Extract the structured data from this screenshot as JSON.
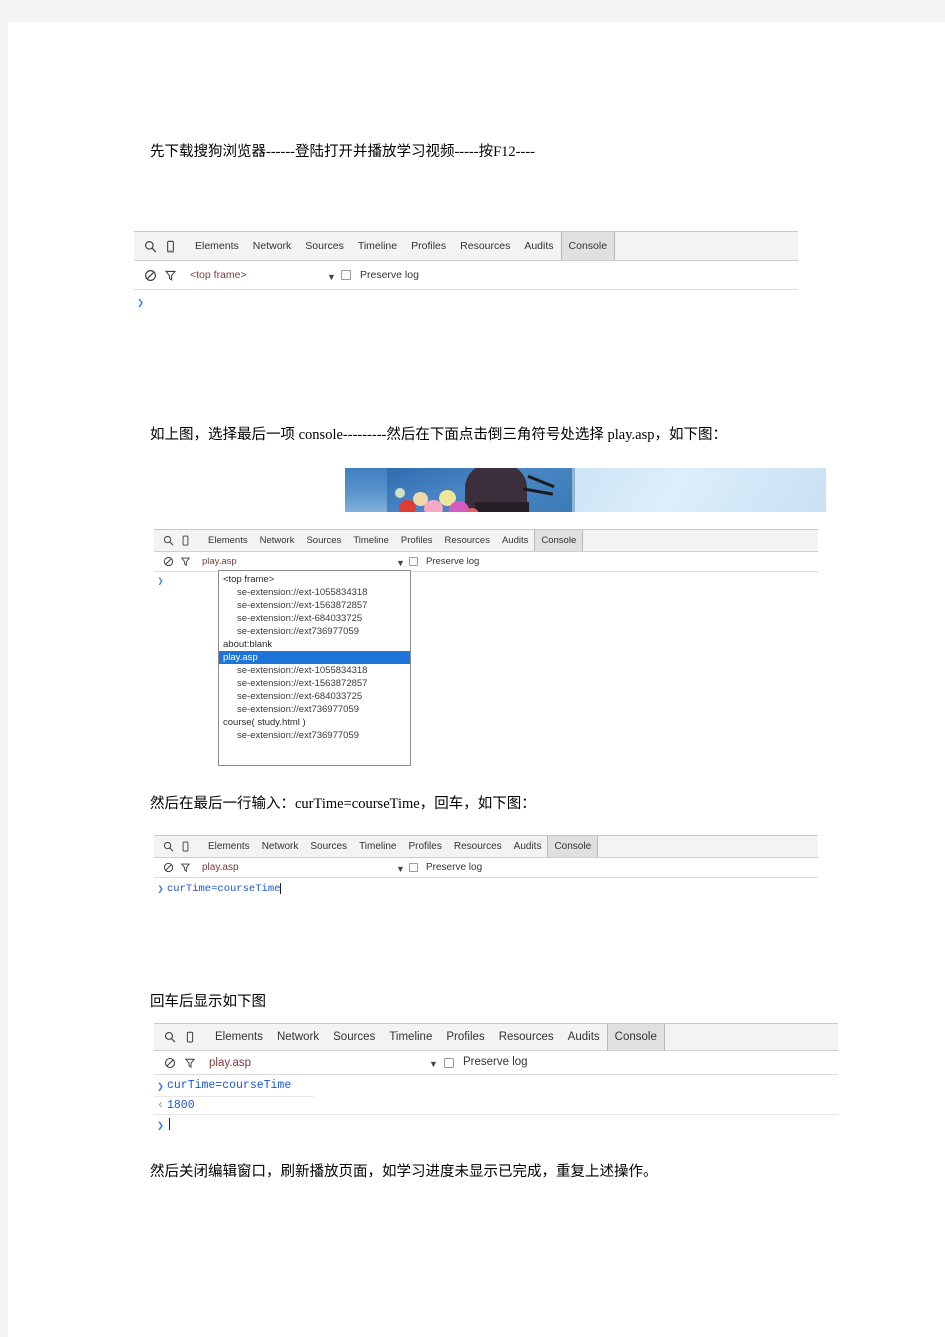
{
  "document": {
    "paragraphs": [
      "先下载搜狗浏览器------登陆打开并播放学习视频-----按F12----",
      "如上图，选择最后一项 console---------然后在下面点击倒三角符号处选择  play.asp，如下图：",
      "然后在最后一行输入：curTime=courseTime，回车，如下图：",
      "回车后显示如下图",
      "然后关闭编辑窗口，刷新播放页面，如学习进度未显示已完成，重复上述操作。"
    ]
  },
  "devtools": {
    "tabs": [
      "Elements",
      "Network",
      "Sources",
      "Timeline",
      "Profiles",
      "Resources",
      "Audits",
      "Console"
    ],
    "active_tab": "Console",
    "icons": {
      "search": "search-icon",
      "device": "device-toggle-icon",
      "clear": "clear-console-icon",
      "filter": "filter-icon",
      "caret": "▼"
    },
    "preserve_log_label": "Preserve log",
    "preserve_log_checked": false
  },
  "panel1": {
    "context": "<top frame>",
    "prompt_symbol": "❯"
  },
  "panel2": {
    "context": "play.asp",
    "prompt_symbol": "❯",
    "dropdown": {
      "options": [
        {
          "label": "<top frame>",
          "indent": false,
          "selected": false
        },
        {
          "label": "se-extension://ext-1055834318",
          "indent": true,
          "selected": false
        },
        {
          "label": "se-extension://ext-1563872857",
          "indent": true,
          "selected": false
        },
        {
          "label": "se-extension://ext-684033725",
          "indent": true,
          "selected": false
        },
        {
          "label": "se-extension://ext736977059",
          "indent": true,
          "selected": false
        },
        {
          "label": "about:blank",
          "indent": false,
          "selected": false
        },
        {
          "label": "play.asp",
          "indent": false,
          "selected": true
        },
        {
          "label": "se-extension://ext-1055834318",
          "indent": true,
          "selected": false
        },
        {
          "label": "se-extension://ext-1563872857",
          "indent": true,
          "selected": false
        },
        {
          "label": "se-extension://ext-684033725",
          "indent": true,
          "selected": false
        },
        {
          "label": "se-extension://ext736977059",
          "indent": true,
          "selected": false
        },
        {
          "label": "course( study.html )",
          "indent": false,
          "selected": false
        },
        {
          "label": "se-extension://ext736977059",
          "indent": true,
          "selected": false
        }
      ]
    }
  },
  "panel3": {
    "context": "play.asp",
    "prompt_symbol": "❯",
    "input_value": "curTime=courseTime"
  },
  "panel4": {
    "context": "play.asp",
    "prompt_symbol": "❯",
    "input_value": "curTime=courseTime",
    "result_arrow": "‹",
    "result_value": "1800",
    "empty_prompt_symbol": "❯"
  },
  "colors": {
    "console_blue": "#1a55d8",
    "context_red": "#7a3b3b",
    "tab_active_bg": "#e0e0e0",
    "selection_blue": "#1f74d8",
    "page_bg": "#ffffff",
    "canvas_bg": "#f4f4f4"
  }
}
